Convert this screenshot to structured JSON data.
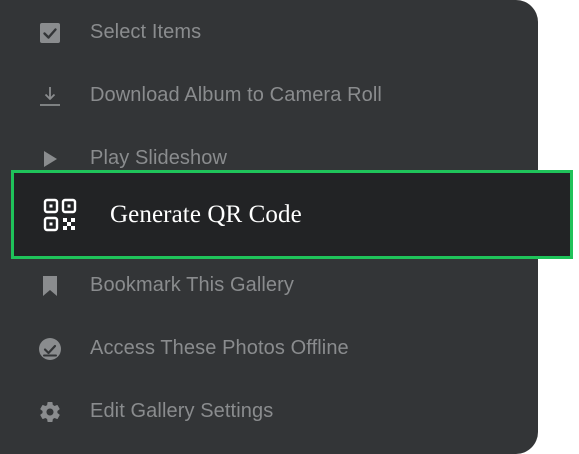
{
  "menu": {
    "items": [
      {
        "label": "Select Items",
        "icon": "checkbox-checked-icon"
      },
      {
        "label": "Download Album to Camera Roll",
        "icon": "download-icon"
      },
      {
        "label": "Play Slideshow",
        "icon": "play-icon"
      },
      {
        "label": "Generate QR Code",
        "icon": "qr-code-icon",
        "highlighted": true
      },
      {
        "label": "Bookmark This Gallery",
        "icon": "bookmark-icon"
      },
      {
        "label": "Access These Photos Offline",
        "icon": "offline-check-icon"
      },
      {
        "label": "Edit Gallery Settings",
        "icon": "gear-icon"
      }
    ]
  },
  "colors": {
    "panel_background": "#333537",
    "highlight_background": "#222325",
    "highlight_border": "#1fc35a",
    "muted_text": "#8a8c8e",
    "active_text": "#ffffff"
  }
}
